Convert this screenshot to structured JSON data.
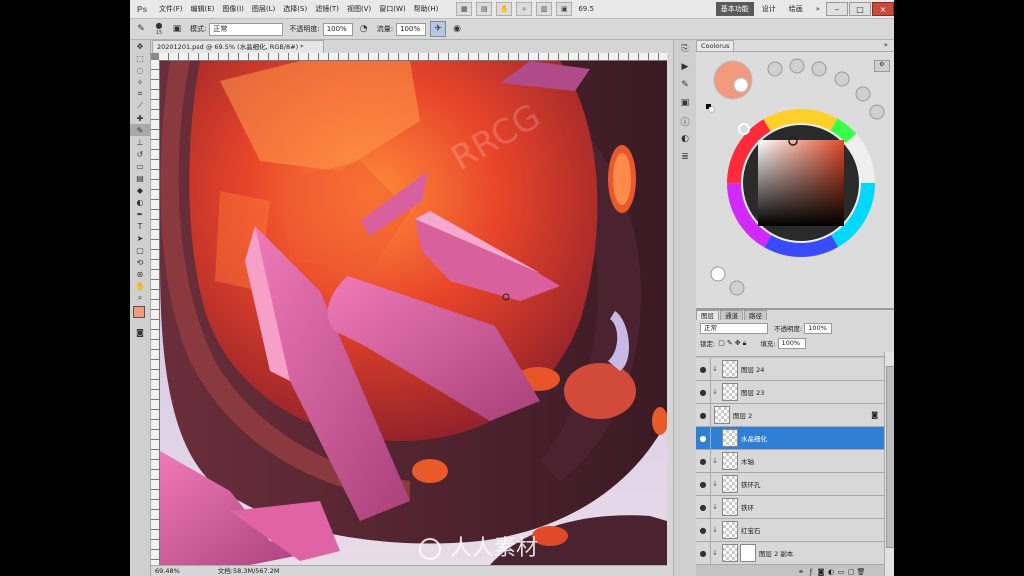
{
  "app": {
    "logo": "Ps"
  },
  "menu": [
    "文件(F)",
    "编辑(E)",
    "图像(I)",
    "图层(L)",
    "选择(S)",
    "滤镜(T)",
    "视图(V)",
    "窗口(W)",
    "帮助(H)"
  ],
  "menubar": {
    "zoom": "69.5",
    "workspaces": [
      "基本功能",
      "设计",
      "绘画"
    ]
  },
  "options": {
    "brush_size": "15",
    "mode_label": "模式:",
    "mode_value": "正常",
    "opacity_label": "不透明度:",
    "opacity_value": "100%",
    "flow_label": "流量:",
    "flow_value": "100%"
  },
  "document": {
    "tab_title": "20201201.psd @ 69.5% (水晶细化, RGB/8#) *",
    "status_zoom": "69.48%",
    "status_doc": "文档:58.3M/567.2M"
  },
  "coolorus": {
    "title": "Coolorus",
    "fg_color": "#f29a80",
    "hue_square_color": "#e04a28"
  },
  "layers": {
    "tabs": [
      "图层",
      "通道",
      "路径"
    ],
    "blend_mode": "正常",
    "opacity_label": "不透明度:",
    "opacity_value": "100%",
    "lock_label": "锁定:",
    "fill_label": "填充:",
    "fill_value": "100%",
    "items": [
      {
        "name": "图层 24"
      },
      {
        "name": "图层 23"
      },
      {
        "name": "图层 2"
      },
      {
        "name": "水晶细化"
      },
      {
        "name": "木轴"
      },
      {
        "name": "铁环孔"
      },
      {
        "name": "铁环"
      },
      {
        "name": "红宝石"
      },
      {
        "name": "图层 2 副本"
      }
    ]
  },
  "watermarks": {
    "brand": "RRCG",
    "site": "人人素材"
  }
}
